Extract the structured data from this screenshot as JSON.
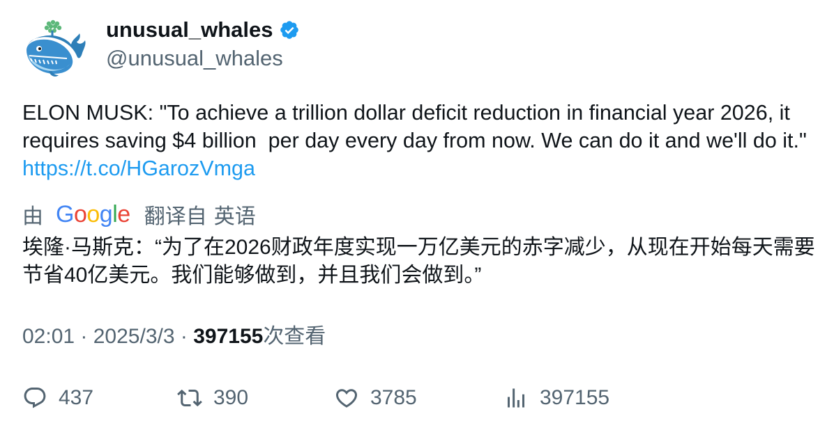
{
  "user": {
    "display_name": "unusual_whales",
    "handle": "@unusual_whales",
    "verified_color": "#1d9bf0",
    "avatar_icon": "whale-avatar-icon"
  },
  "tweet": {
    "text": "ELON MUSK: \"To achieve a trillion dollar deficit reduction in financial year 2026, it requires saving $4 billion  per day every day from now. We can do it and we'll do it.\" ",
    "link": "https://t.co/HGarozVmga",
    "link_color": "#1d9bf0"
  },
  "translation": {
    "by_label": "由",
    "provider": "Google",
    "translate_label": "翻译自",
    "source_language": "英语",
    "text": "埃隆·马斯克：“为了在2026财政年度实现一万亿美元的赤字减少，从现在开始每天需要节省40亿美元。我们能够做到，并且我们会做到。”"
  },
  "meta": {
    "time": "02:01",
    "separator": " · ",
    "date": "2025/3/3",
    "views": "397155",
    "views_label": "次查看"
  },
  "actions": {
    "replies": "437",
    "retweets": "390",
    "likes": "3785",
    "views": "397155"
  },
  "colors": {
    "text": "#0f1419",
    "secondary": "#536471",
    "google_blue": "#4285F4",
    "google_red": "#EA4335",
    "google_yellow": "#FBBC05",
    "google_green": "#34A853"
  }
}
